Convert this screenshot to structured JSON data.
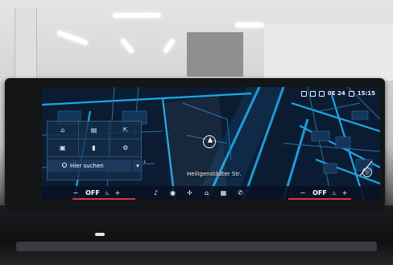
{
  "status_bar": {
    "temperature": "0E 24",
    "time": "15:15"
  },
  "quick_panel": {
    "search_placeholder": "Hier suchen"
  },
  "map": {
    "street_label": "Heiligenstädter Str."
  },
  "climate_left": {
    "minus": "−",
    "value": "OFF",
    "plus": "+"
  },
  "climate_right": {
    "minus": "−",
    "value": "OFF",
    "plus": "+"
  },
  "colors": {
    "map_background": "#0a1a2e",
    "road_blue": "#1e9bd6",
    "accent_red": "#e0304a",
    "panel": "#142d4b"
  },
  "icons": {
    "bottom_bar": [
      "music-icon",
      "connectivity-icon",
      "fan-icon",
      "home-icon",
      "apps-icon",
      "phone-icon"
    ]
  }
}
